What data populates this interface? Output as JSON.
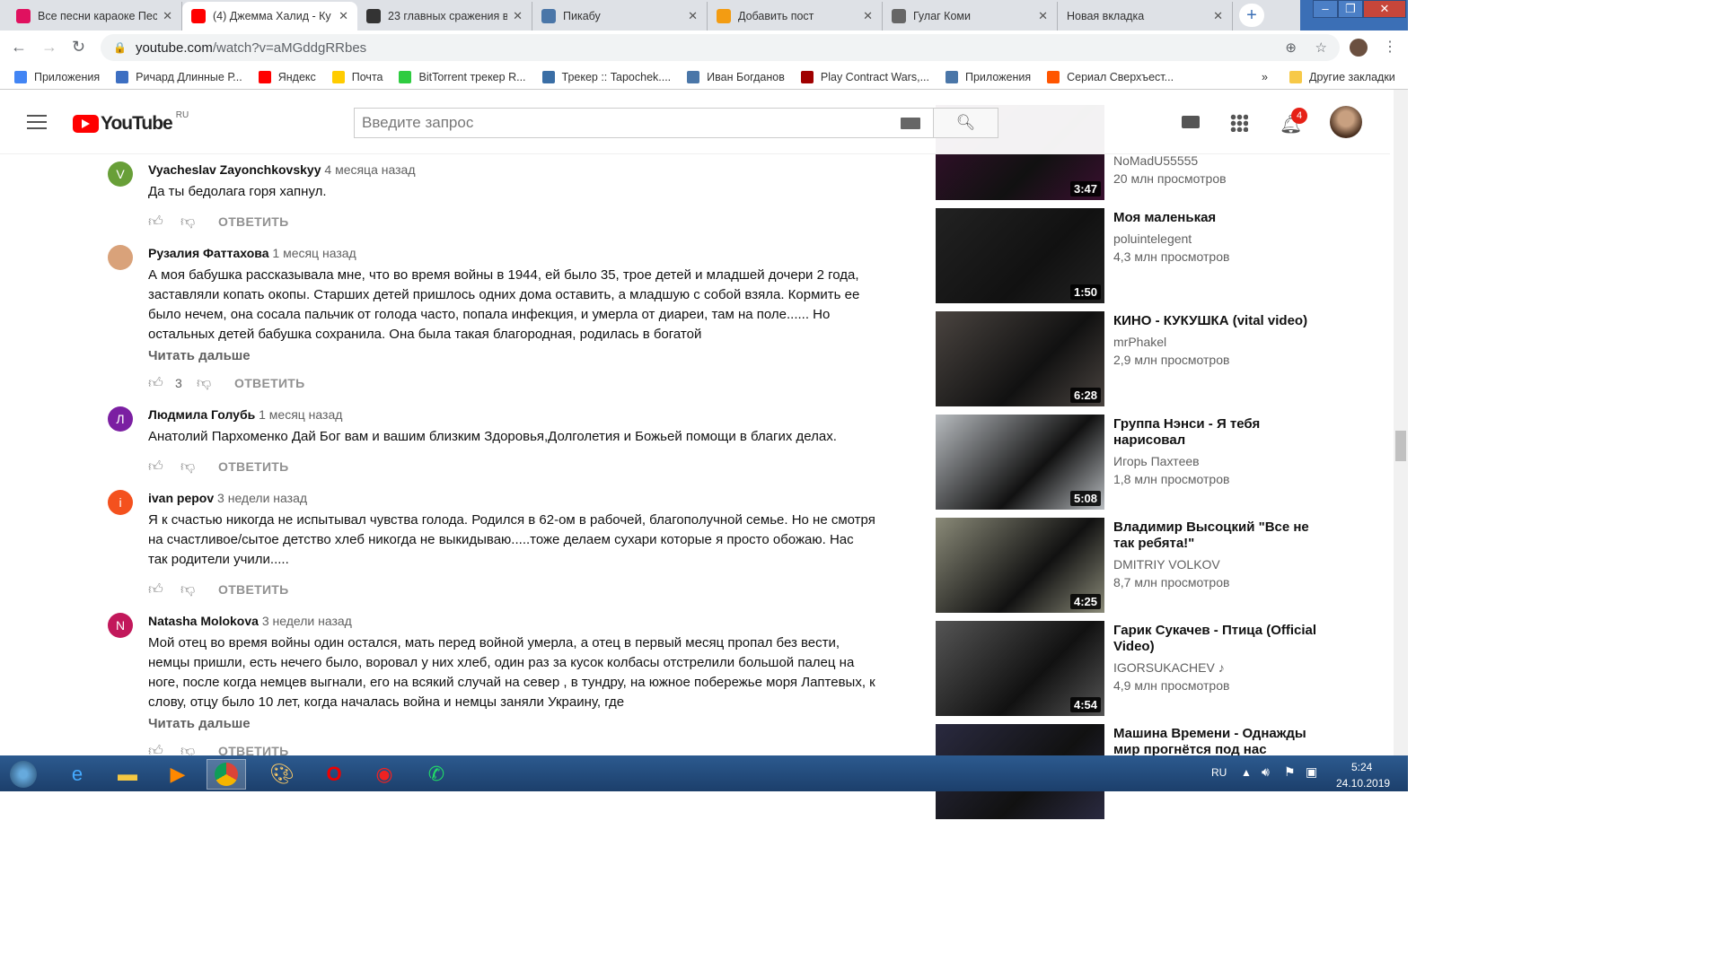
{
  "browser": {
    "tabs": [
      {
        "title": "Все песни караоке Пес",
        "icon": "karaoke-icon",
        "color": "#e0115f",
        "active": false
      },
      {
        "title": "(4) Джемма Халид - Ку",
        "icon": "youtube-icon",
        "color": "#ff0000",
        "active": true
      },
      {
        "title": "23 главных сражения в",
        "icon": "p-icon",
        "color": "#333333",
        "active": false
      },
      {
        "title": "Пикабу",
        "icon": "vk-icon",
        "color": "#4a76a8",
        "active": false
      },
      {
        "title": "Добавить пост",
        "icon": "pikabu-icon",
        "color": "#f39c12",
        "active": false
      },
      {
        "title": "Гулаг Коми",
        "icon": "globe-icon",
        "color": "#666666",
        "active": false
      },
      {
        "title": "Новая вкладка",
        "icon": "",
        "color": "",
        "active": false
      }
    ],
    "url_host": "youtube.com",
    "url_path": "/watch?v=aMGddgRRbes",
    "bookmarks": [
      {
        "label": "Приложения",
        "color": "#4285f4"
      },
      {
        "label": "Ричард Длинные Р...",
        "color": "#3d6fc2"
      },
      {
        "label": "Яндекс",
        "color": "#ff0000"
      },
      {
        "label": "Почта",
        "color": "#ffcc00"
      },
      {
        "label": "BitTorrent трекер R...",
        "color": "#2ecc40"
      },
      {
        "label": "Трекер :: Tapochek....",
        "color": "#3a6ea5"
      },
      {
        "label": "Иван Богданов",
        "color": "#4a76a8"
      },
      {
        "label": "Play Contract Wars,...",
        "color": "#a00000"
      },
      {
        "label": "Приложения",
        "color": "#4a76a8"
      },
      {
        "label": "Сериал Сверхъест...",
        "color": "#ff5500"
      }
    ],
    "bookmarks_overflow": "»",
    "other_bookmarks": "Другие закладки"
  },
  "youtube": {
    "logo_text": "YouTube",
    "region": "RU",
    "search_placeholder": "Введите запрос",
    "notifications": "4"
  },
  "comments": [
    {
      "author": "Vyacheslav Zayonchkovskyy",
      "time": "4 месяца назад",
      "avatar_letter": "V",
      "avatar_color": "#689f38",
      "text": "Да ты бедолага горя  хапнул.",
      "likes": "",
      "read_more": "",
      "reply": "ОТВЕТИТЬ"
    },
    {
      "author": "Рузалия Фаттахова",
      "time": "1 месяц назад",
      "avatar_letter": "",
      "avatar_color": "#d9a27a",
      "text": "А моя бабушка рассказывала мне, что во время войны в 1944, ей было 35, трое детей и младшей дочери 2 года, заставляли копать окопы. Старших детей пришлось одних дома оставить, а младшую с собой взяла. Кормить ее было нечем, она сосала пальчик от голода часто, попала инфекция, и умерла от диареи, там на поле...... Но остальных детей бабушка сохранила. Она была такая благородная, родилась в богатой",
      "likes": "3",
      "read_more": "Читать дальше",
      "reply": "ОТВЕТИТЬ"
    },
    {
      "author": "Людмила Голубь",
      "time": "1 месяц назад",
      "avatar_letter": "Л",
      "avatar_color": "#7b1fa2",
      "text": "Анатолий Пархоменко Дай Бог вам и вашим близким Здоровья,Долголетия и Божьей помощи в благих делах.",
      "likes": "",
      "read_more": "",
      "reply": "ОТВЕТИТЬ"
    },
    {
      "author": "ivan pepov",
      "time": "3 недели назад",
      "avatar_letter": "i",
      "avatar_color": "#f4511e",
      "text": "Я к счастью никогда не испытывал чувства голода. Родился в 62-ом в рабочей, благополучной семье. Но не смотря на счастливое/сытое детство хлеб никогда не выкидываю.....тоже делаем сухари которые я просто обожаю. Нас так родители учили.....",
      "likes": "",
      "read_more": "",
      "reply": "ОТВЕТИТЬ"
    },
    {
      "author": "Natasha Molokova",
      "time": "3 недели назад",
      "avatar_letter": "N",
      "avatar_color": "#c2185b",
      "text": "Мой отец во время войны один остался, мать перед войной умерла, а отец в первый месяц пропал без вести, немцы пришли, есть нечего было, воровал у них хлеб, один раз за кусок колбасы отстрелили большой палец на ноге, после когда немцев выгнали,  его на всякий случай на север , в тундру, на южное побережье моря Лаптевых, к слову, отцу было 10 лет, когда началась война и немцы заняли Украину, где",
      "likes": "",
      "read_more": "Читать дальше",
      "reply": "ОТВЕТИТЬ"
    }
  ],
  "related": [
    {
      "title": "",
      "channel": "NoMadU55555",
      "views": "20 млн просмотров",
      "duration": "3:47",
      "thumb": "#3a1030"
    },
    {
      "title": "Моя маленькая",
      "channel": "poluintelegent",
      "views": "4,3 млн просмотров",
      "duration": "1:50",
      "thumb": "#222222"
    },
    {
      "title": "КИНО - КУКУШКА (vital video)",
      "channel": "mrPhakel",
      "views": "2,9 млн просмотров",
      "duration": "6:28",
      "thumb": "#4a4440"
    },
    {
      "title": "Группа Нэнси - Я тебя нарисовал",
      "channel": "Игорь Пахтеев",
      "views": "1,8 млн просмотров",
      "duration": "5:08",
      "thumb": "#b8bcc0"
    },
    {
      "title": "Владимир Высоцкий \"Все не так ребята!\"",
      "channel": "DMITRIY VOLKOV",
      "views": "8,7 млн просмотров",
      "duration": "4:25",
      "thumb": "#8a8a78"
    },
    {
      "title": "Гарик Сукачев - Птица (Official Video)",
      "channel": "IGORSUKACHEV",
      "views": "4,9 млн просмотров",
      "duration": "4:54",
      "thumb": "#555555",
      "music_note": "♪"
    },
    {
      "title": "Машина Времени - Однажды мир прогнётся под нас",
      "channel": "",
      "views": "",
      "duration": "",
      "thumb": "#2a2a40"
    }
  ],
  "taskbar": {
    "lang": "RU",
    "time": "5:24",
    "date": "24.10.2019"
  }
}
